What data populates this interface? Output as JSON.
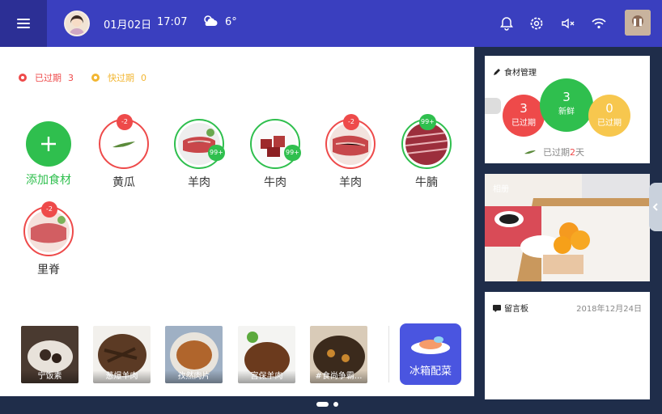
{
  "header": {
    "date": "01月02日",
    "time": "17:07",
    "temperature": "6°",
    "icons": [
      "menu-icon",
      "avatar",
      "cloud-weather-icon",
      "bell-icon",
      "gear-icon",
      "mute-icon",
      "wifi-icon",
      "user-photo"
    ]
  },
  "status": {
    "expired_label": "已过期",
    "expired_count": "3",
    "soon_label": "快过期",
    "soon_count": "0"
  },
  "foods": [
    {
      "name": "添加食材",
      "type": "add"
    },
    {
      "name": "黄瓜",
      "badge": "-2",
      "state": "expired"
    },
    {
      "name": "羊肉",
      "badge": "99+",
      "state": "fresh"
    },
    {
      "name": "牛肉",
      "badge": "99+",
      "state": "fresh"
    },
    {
      "name": "羊肉",
      "badge": "-2",
      "state": "expired"
    },
    {
      "name": "牛腩",
      "badge": "99+",
      "state": "fresh"
    },
    {
      "name": "里脊",
      "badge": "-2",
      "state": "expired"
    }
  ],
  "recipes": [
    {
      "title": "宁饭素"
    },
    {
      "title": "葱爆羊肉"
    },
    {
      "title": "孜然肉片"
    },
    {
      "title": "宫保羊肉"
    },
    {
      "title": "#食尚争霸..."
    }
  ],
  "fridge_button": "冰箱配菜",
  "food_card": {
    "title": "食材管理",
    "expired_count": "3",
    "expired_label": "已过期",
    "fresh_count": "3",
    "fresh_label": "新鲜",
    "soon_count": "0",
    "soon_label": "已过期",
    "footer_text": "已过期",
    "footer_days": "2",
    "footer_unit": "天"
  },
  "photo_card": {
    "label": "相册"
  },
  "message_card": {
    "title": "留言板",
    "date": "2018年12月24日"
  },
  "colors": {
    "topbar": "#3a3fbf",
    "menu_button": "#2c2f95",
    "green": "#2fbf4e",
    "red": "#ee4a4a",
    "yellow": "#f2b632",
    "fridge_button": "#4a55e0",
    "background": "#1f2d4a"
  }
}
